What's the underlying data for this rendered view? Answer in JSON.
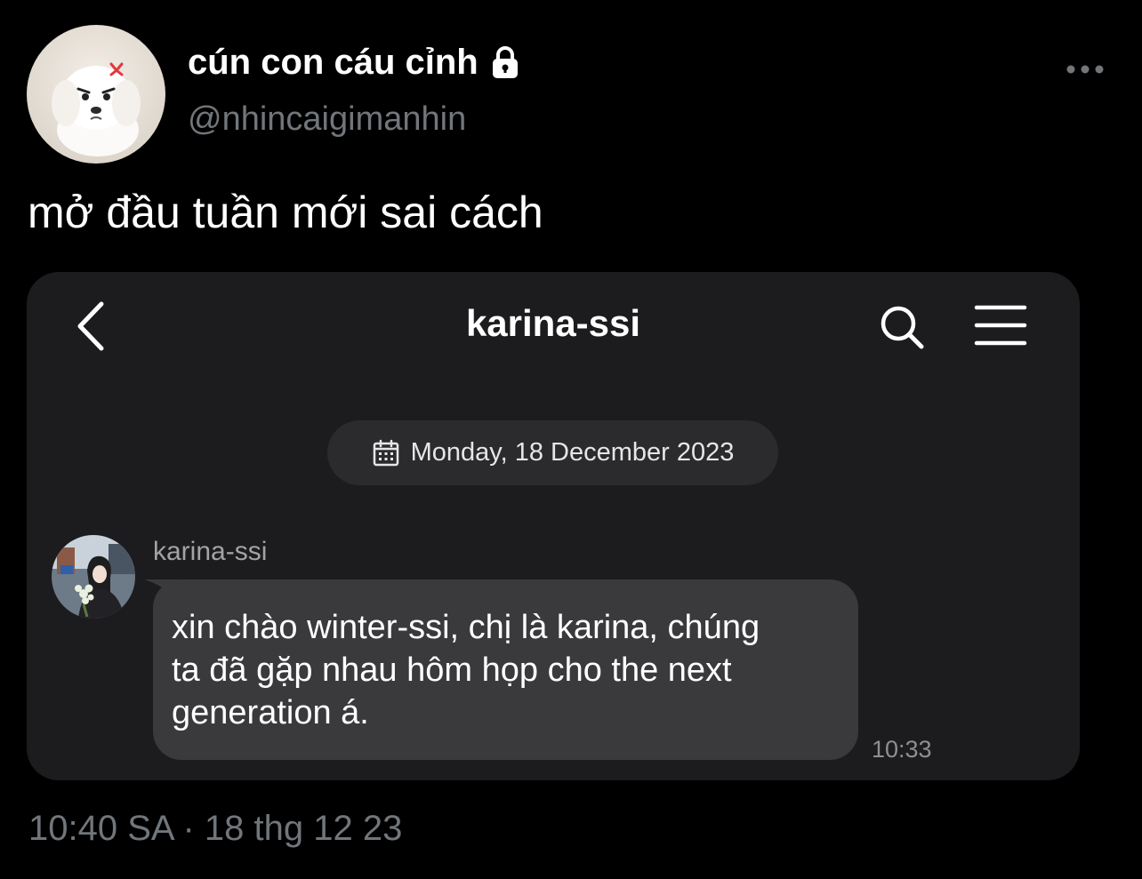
{
  "tweet": {
    "display_name": "cún con cáu cỉnh",
    "handle": "@nhincaigimanhin",
    "text": "mở đầu tuần mới sai cách",
    "timestamp": "10:40 SA · 18 thg 12 23",
    "icons": {
      "protected": "lock-icon",
      "more": "more-horizontal-icon"
    }
  },
  "embedded_chat": {
    "title": "karina-ssi",
    "icons": {
      "back": "chevron-left-icon",
      "search": "search-icon",
      "menu": "hamburger-menu-icon",
      "date": "calendar-icon"
    },
    "date_label": "Monday, 18 December 2023",
    "message": {
      "sender": "karina-ssi",
      "lines": [
        "xin chào winter-ssi, chị là karina, chúng",
        "ta đã gặp nhau hôm họp cho the next",
        "generation á."
      ],
      "time": "10:33"
    }
  },
  "colors": {
    "background": "#000000",
    "secondary_text": "#71767b",
    "card_background": "#1c1c1e",
    "bubble_background": "#3a3a3c",
    "date_pill_background": "#2b2b2e"
  }
}
